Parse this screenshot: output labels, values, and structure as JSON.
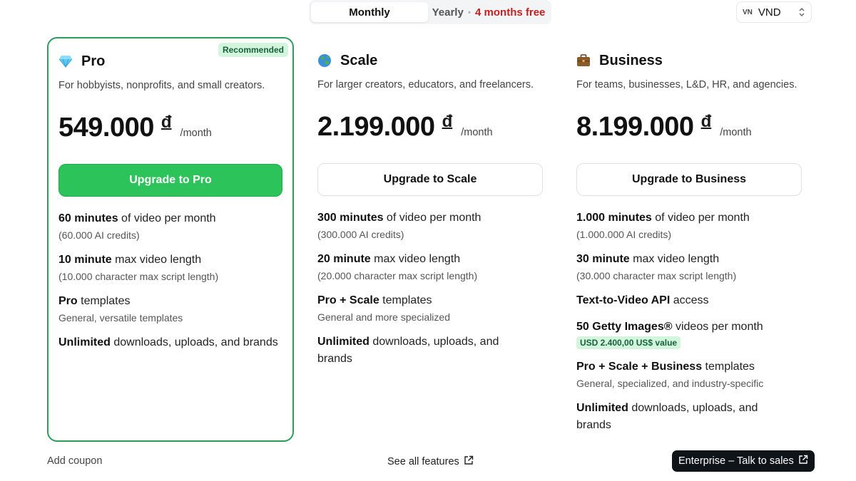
{
  "billing": {
    "monthly_label": "Monthly",
    "yearly_label": "Yearly",
    "separator": "•",
    "yearly_promo": "4 months free"
  },
  "currency": {
    "flag_label": "VN",
    "code": "VND"
  },
  "plans": [
    {
      "icon": "diamond-icon",
      "name": "Pro",
      "badge": "Recommended",
      "description": "For hobbyists, nonprofits, and small creators.",
      "price": "549.000",
      "currency_symbol": "đ",
      "period": "/month",
      "cta": "Upgrade to Pro",
      "features": [
        {
          "bold": "60 minutes",
          "text": " of video per month",
          "sub": "(60.000 AI credits)"
        },
        {
          "bold": "10 minute",
          "text": " max video length",
          "sub": "(10.000 character max script length)"
        },
        {
          "bold": "Pro",
          "text": " templates",
          "sub": "General, versatile templates"
        },
        {
          "bold": "Unlimited",
          "text": " downloads, uploads, and brands",
          "sub": ""
        }
      ]
    },
    {
      "icon": "globe-icon",
      "name": "Scale",
      "description": "For larger creators, educators, and freelancers.",
      "price": "2.199.000",
      "currency_symbol": "đ",
      "period": "/month",
      "cta": "Upgrade to Scale",
      "features": [
        {
          "bold": "300 minutes",
          "text": " of video per month",
          "sub": "(300.000 AI credits)"
        },
        {
          "bold": "20 minute",
          "text": " max video length",
          "sub": "(20.000 character max script length)"
        },
        {
          "bold": "Pro + Scale",
          "text": " templates",
          "sub": "General and more specialized"
        },
        {
          "bold": "Unlimited",
          "text": " downloads, uploads, and brands",
          "sub": ""
        }
      ]
    },
    {
      "icon": "briefcase-icon",
      "name": "Business",
      "description": "For teams, businesses, L&D, HR, and agencies.",
      "price": "8.199.000",
      "currency_symbol": "đ",
      "period": "/month",
      "cta": "Upgrade to Business",
      "features": [
        {
          "bold": "1.000 minutes",
          "text": " of video per month",
          "sub": "(1.000.000 AI credits)"
        },
        {
          "bold": "30 minute",
          "text": " max video length",
          "sub": "(30.000 character max script length)"
        },
        {
          "bold": "Text-to-Video API",
          "text": " access",
          "sub": ""
        },
        {
          "bold": "50 Getty Images®",
          "text": " videos per month",
          "value_badge": "USD 2.400,00 US$ value"
        },
        {
          "bold": "Pro + Scale + Business",
          "text": " templates",
          "sub": "General, specialized, and industry-specific"
        },
        {
          "bold": "Unlimited",
          "text": " downloads, uploads, and brands",
          "sub": ""
        }
      ]
    }
  ],
  "footer": {
    "coupon": "Add coupon",
    "see_all": "See all features",
    "enterprise": "Enterprise – Talk to sales"
  },
  "colors": {
    "accent_green": "#2bc35a",
    "card_border": "#2e9d5c",
    "promo_red": "#c81e1e",
    "enterprise_bg": "#0f1419"
  }
}
